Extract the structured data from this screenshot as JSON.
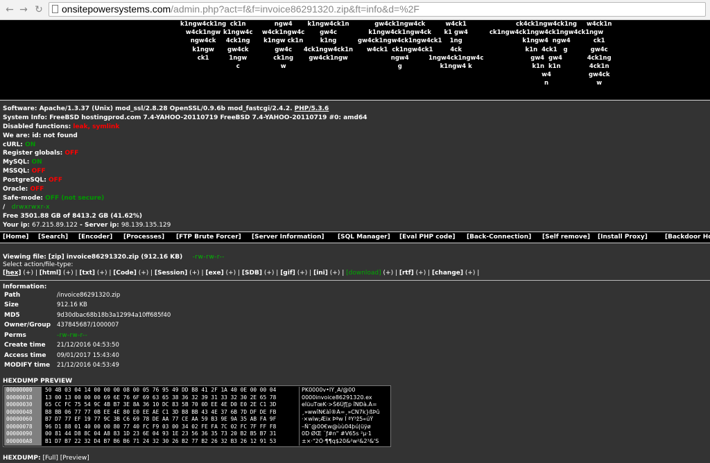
{
  "browser": {
    "back_icon": "back-arrow-icon",
    "forward_icon": "forward-arrow-icon",
    "reload_icon": "reload-icon",
    "url_host": "onsitepowersystems.com",
    "url_path": "/admin.php?act=f&f=invoice86291320.zip&ft=info&d=%2F"
  },
  "logo_columns": [
    "k1ngw4ck1ng\nw4ck1ngw\nngw4ck\nk1ngw\nck1",
    "ck1n\nk1ngw4c\n4ck1ng\ngw4ck\n1ngw\nc",
    "ngw4\nw4ck1ngw4c\nk1ngw ck1n\ngw4c\nck1ng\nw",
    "k1ngw4ck1n\ngw4c\nk1ng\n4ck1ngw4ck1n\ngw4ck1ngw",
    "gw4ck1ngw4ck\nk1ngw4ck1ngw4ck\ngw4ck1ngw4ck1ngw4ck1\nw4ck1  ck1ngw4ck1\nngw4\ng",
    "w4ck1\nk1 gw4\n1ng\n4ck\n1ngw4ck1ngw4c\nk1ngw4 k",
    "ck4ck1ngw4ck1ng\nck1ngw4ck1ngw4ck1ngw4ck1ngw\nk1ngw4  ngw4\nk1n  4ck1   g\ngw4  gw4\nk1n  k1n\nw4\nn",
    "w4ck1n\n\nck1\ngw4c\n4ck1ng\n4ck1n\ngw4ck\nw"
  ],
  "sysinfo": {
    "software_label": "Software:",
    "software_value": "Apache/1.3.37 (Unix) mod_ssl/2.8.28 OpenSSL/0.9.6b mod_fastcgi/2.4.2.",
    "php_link": "PHP/5.3.6",
    "system_label": "System Info:",
    "system_value": "FreeBSD hostingprod.com 7.4-YAHOO-20110719 FreeBSD 7.4-YAHOO-20110719 #0: amd64",
    "disabled_label": "Disabled functions:",
    "disabled_value": "leak, symlink",
    "we_are": "We are: id: not found",
    "curl_label": "cURL:",
    "curl_value": "ON",
    "register_label": "Register globals:",
    "register_value": "OFF",
    "mysql_label": "MySQL:",
    "mysql_value": "ON",
    "mssql_label": "MSSQL:",
    "mssql_value": "OFF",
    "postgres_label": "PostgreSQL:",
    "postgres_value": "OFF",
    "oracle_label": "Oracle:",
    "oracle_value": "OFF",
    "safemode_label": "Safe-mode:",
    "safemode_value": "OFF (not secure)",
    "root_dir": "/",
    "root_perms": "drwxrwxr-x",
    "free_space": "Free 3501.88 GB of 8413.2 GB (41.62%)",
    "your_ip_label": "Your ip:",
    "your_ip_value": "67.215.89.122",
    "server_ip_label": "- Server ip:",
    "server_ip_value": "98.139.135.129"
  },
  "menu": [
    "[Home]",
    "[Search]",
    "[Encoder]",
    "[Processes]",
    "[FTP Brute Forcer]",
    "[Server Information]",
    "[SQL Manager]",
    "[Eval PHP code]",
    "[Back-Connection]",
    "[Self remove]",
    "[Install Proxy]",
    "[Backdoor Host]"
  ],
  "viewing": {
    "label": "Viewing file:",
    "file": "[zip] invoice86291320.zip (912.16 KB)",
    "perms": "-rw-rw-r--",
    "select_label": "Select action/file-type:",
    "actions": [
      {
        "name": "[hex]",
        "plus": "(+)"
      },
      {
        "name": "[html]",
        "plus": "(+)"
      },
      {
        "name": "[txt]",
        "plus": "(+)"
      },
      {
        "name": "[Code]",
        "plus": "(+)"
      },
      {
        "name": "[Session]",
        "plus": "(+)"
      },
      {
        "name": "[exe]",
        "plus": "(+)"
      },
      {
        "name": "[SDB]",
        "plus": "(+)"
      },
      {
        "name": "[gif]",
        "plus": "(+)"
      },
      {
        "name": "[ini]",
        "plus": "(+)"
      },
      {
        "name": "[download]",
        "plus": "(+)"
      },
      {
        "name": "[rtf]",
        "plus": "(+)"
      },
      {
        "name": "[change]",
        "plus": "(+)"
      }
    ]
  },
  "info": {
    "title": "Information:",
    "rows": [
      {
        "label": "Path",
        "value": "/invoice86291320.zip"
      },
      {
        "label": "Size",
        "value": "912.16 KB"
      },
      {
        "label": "MD5",
        "value": "9d30dbac68b18b3a12994a10ff685f40"
      },
      {
        "label": "Owner/Group",
        "value": "437845687/1000007"
      },
      {
        "label": "Perms",
        "value": "-rw-rw-r--"
      },
      {
        "label": "Create time",
        "value": "21/12/2016 04:53:50"
      },
      {
        "label": "Access time",
        "value": "09/01/2017 15:43:40"
      },
      {
        "label": "MODIFY time",
        "value": "21/12/2016 04:53:49"
      }
    ]
  },
  "hexdump": {
    "title": "HEXDUMP PREVIEW",
    "offsets": [
      "00000000",
      "00000018",
      "00000030",
      "00000048",
      "00000060",
      "00000078",
      "00000090",
      "000000A8"
    ],
    "bytes": [
      "50 4B 03 04 14 00 00 00 08 00 05 76 95 49 DD B8 41 2F 1A 40 0E 00 00 04",
      "13 00 13 00 00 00 69 6E 76 6F 69 63 65 38 36 32 39 31 33 32 30 2E 65 78",
      "65 CC FC 75 54 9C 4B B7 3E 8A 36 10 DC 83 5B 70 0D EE 4E D0 E0 2E C1 3D",
      "B8 BB 06 77 77 0B EE 4E 80 E0 EE AE C1 3D B8 BB 43 4E 37 6B 7D DF DE FB",
      "B7 D7 77 EF 19 77 9C 3B C6 69 78 DE AA 77 CE AA 59 B3 9E 9A 35 AB FA 9F",
      "96 D1 88 01 40 00 00 80 77 40 FC F9 03 00 34 02 FE FA 7C 02 FC 7F FF F8",
      "00 81 44 D8 8C 04 A8 83 1D 23 6E 04 93 1E 23 56 36 35 73 20 B2 B5 B7 31",
      "B1 D7 B7 22 32 D4 B7 B6 B6 71 24 32 30 26 B2 77 B2 26 32 B3 26 12 91 53"
    ],
    "ascii": [
      "PK0000v•IÝ¸A/@00",
      "0000invoice86291320.ex",
      "eÌüuTœK·>Š6Üƒ[p îNÐà.Á=",
      "¸»wwîN€àî®Á=¸»CN7k}ßÞû",
      "·×wïw;Æix Þªw Î ªY³ž5«úŸ",
      "–Ñ˜@00€w@ùù04þú|üÿø",
      "0D ØŒ ¨ƒ#n\" #V65s ²µ·1",
      "±×·\"2Ô·¶¶q$20&²w²&2³&'S"
    ],
    "footer_label": "HEXDUMP:",
    "footer_full": "[Full]",
    "footer_preview": "[Preview]"
  }
}
